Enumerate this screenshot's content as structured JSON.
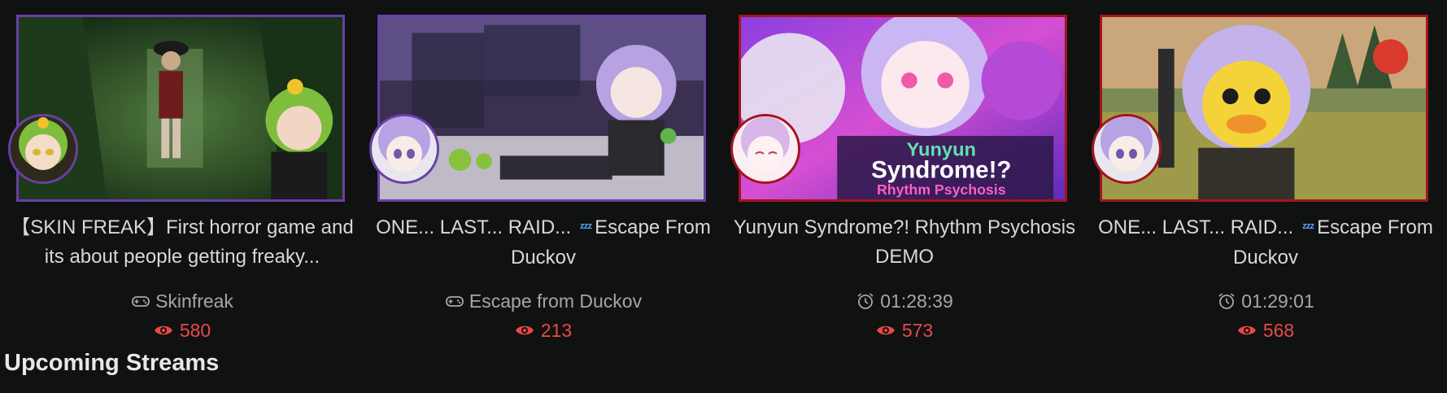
{
  "streams": [
    {
      "title": "【SKIN FREAK】First horror game and its about people getting freaky...",
      "meta_icon": "gamepad-icon",
      "meta_text": "Skinfreak",
      "views": "580",
      "border": "purple"
    },
    {
      "title_part1": "ONE... LAST... RAID...",
      "title_part2": "Escape From Duckov",
      "title_emoji": "ᶻᶻᶻ",
      "meta_icon": "gamepad-icon",
      "meta_text": "Escape from Duckov",
      "views": "213",
      "border": "purple"
    },
    {
      "title": "Yunyun Syndrome?! Rhythm Psychosis DEMO",
      "meta_icon": "alarm-clock-icon",
      "meta_text": "01:28:39",
      "views": "573",
      "border": "red",
      "thumb_text_1": "Yunyun",
      "thumb_text_2": "Syndrome!?",
      "thumb_text_3": "Rhythm Psychosis"
    },
    {
      "title_part1": "ONE... LAST... RAID...",
      "title_part2": "Escape From Duckov",
      "title_emoji": "ᶻᶻᶻ",
      "meta_icon": "alarm-clock-icon",
      "meta_text": "01:29:01",
      "views": "568",
      "border": "red"
    }
  ],
  "section_title": "Upcoming Streams",
  "colors": {
    "background": "#101111",
    "live_border": "#6a3fa6",
    "vod_border": "#a3141d",
    "views": "#ec4747"
  }
}
